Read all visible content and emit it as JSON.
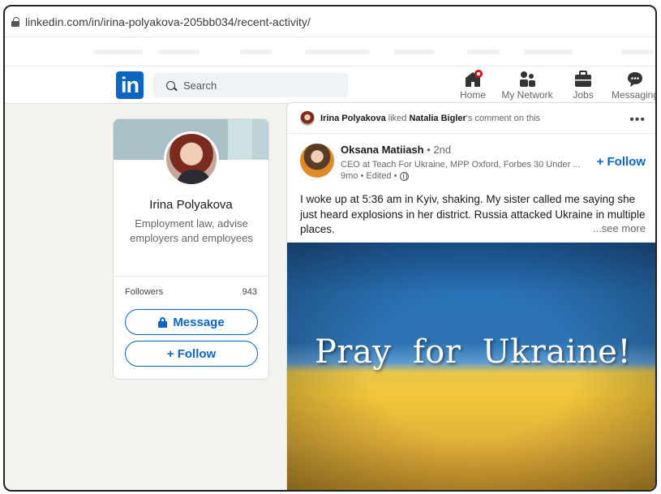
{
  "browser": {
    "url": "linkedin.com/in/irina-polyakova-205bb034/recent-activity/"
  },
  "nav": {
    "logo": "in",
    "search_placeholder": "Search",
    "items": [
      {
        "label": "Home",
        "icon": "home-icon"
      },
      {
        "label": "My Network",
        "icon": "network-icon"
      },
      {
        "label": "Jobs",
        "icon": "briefcase-icon"
      },
      {
        "label": "Messaging",
        "icon": "messaging-icon"
      }
    ]
  },
  "profile": {
    "name": "Irina Polyakova",
    "headline": "Employment law, advise employers and employees",
    "followers_label": "Followers",
    "followers_count": "943",
    "message_label": "Message",
    "follow_label": "+ Follow"
  },
  "post": {
    "activity": {
      "actor": "Irina Polyakova",
      "verb": " liked ",
      "target": "Natalia Bigler",
      "suffix": "'s comment on this"
    },
    "author": {
      "name": "Oksana Matiiash",
      "degree": " • 2nd",
      "subtitle": "CEO at Teach For Ukraine, MPP Oxford, Forbes 30 Under ...",
      "meta": "9mo • Edited •"
    },
    "follow_label": "+ Follow",
    "text": "I woke up at 5:36 am in Kyiv, shaking. My sister called me saying she just heard explosions in her district. Russia attacked Ukraine in multiple places.",
    "see_more": "...see more",
    "image_caption": "Pray  for  Ukraine!"
  },
  "colors": {
    "brand": "#0a66c2",
    "background": "#f3f2ef",
    "notification": "#cc1016"
  }
}
